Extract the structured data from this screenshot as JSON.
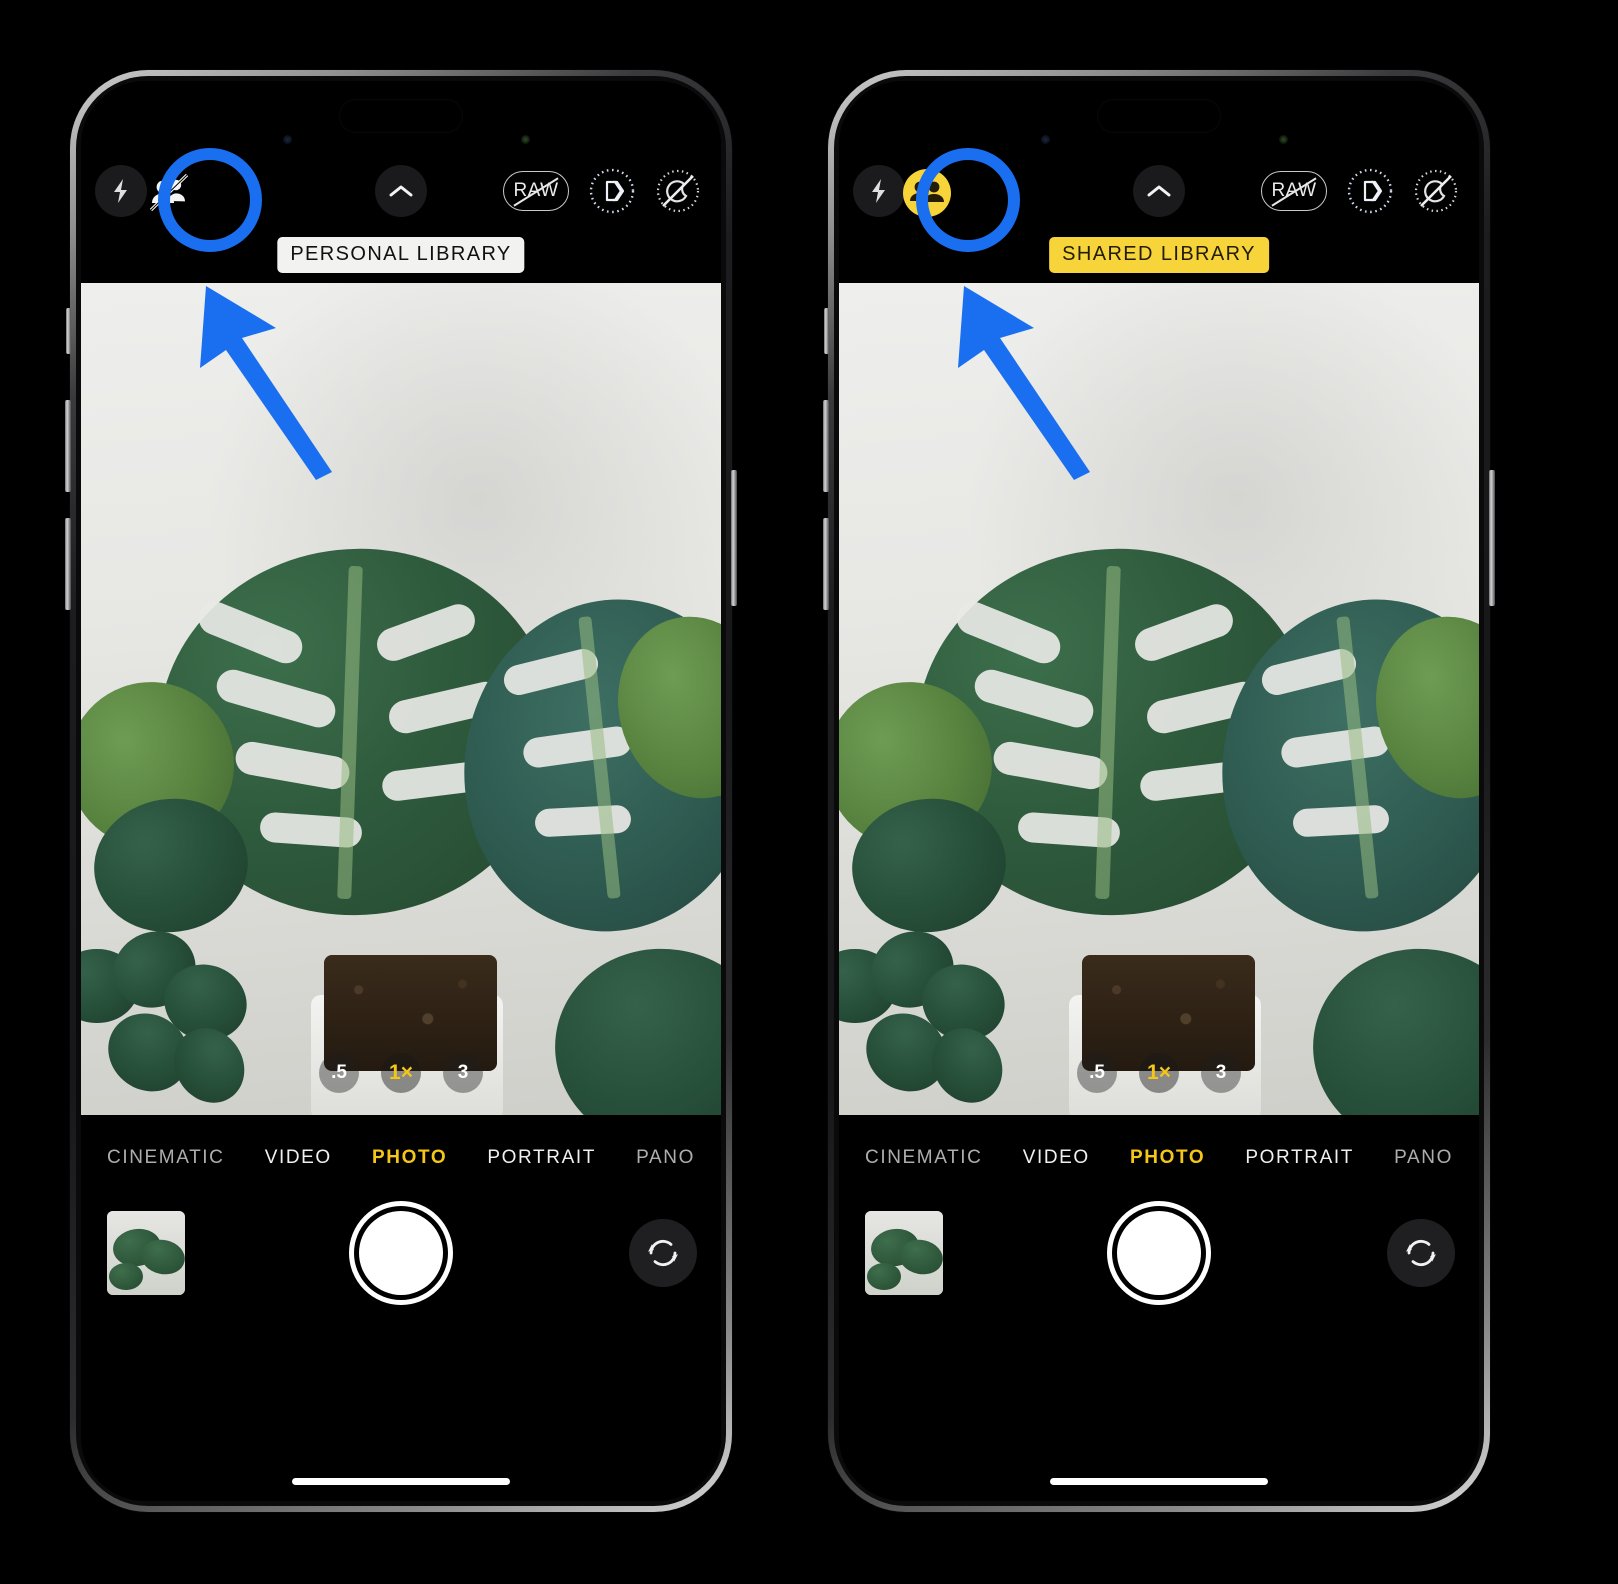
{
  "app": {
    "name": "Camera",
    "platform": "iOS",
    "device": "iPhone 14 Pro"
  },
  "accent_colors": {
    "annotation_blue": "#1a6ff0",
    "shared_yellow": "#f6d43a",
    "mode_active_yellow": "#f5c518",
    "badge_white": "#f2f2f0",
    "badge_text_dark": "#231c06"
  },
  "panels": [
    {
      "id": "personal",
      "name": "personal-library-state",
      "library_badge": {
        "label": "PERSONAL LIBRARY",
        "style": "white",
        "background": "#f2f2f0",
        "text_color": "#111111"
      },
      "shared_library_toggle": {
        "name": "shared-library-toggle",
        "state": "off",
        "icon": "people-slash-icon",
        "icon_color": "#ffffff",
        "highlighted": true
      },
      "top_controls": [
        {
          "name": "flash-button",
          "icon": "flash-icon",
          "label": ""
        },
        {
          "name": "more-controls-button",
          "icon": "chevron-up-icon",
          "label": ""
        },
        {
          "name": "raw-toggle",
          "icon": "raw-off-icon",
          "label": "RAW",
          "state": "off"
        },
        {
          "name": "live-photo-toggle",
          "icon": "live-photo-icon",
          "state": "on"
        },
        {
          "name": "night-mode-toggle",
          "icon": "night-mode-off-icon",
          "state": "off"
        }
      ],
      "zoom_levels": [
        {
          "label": ".5",
          "active": false
        },
        {
          "label": "1×",
          "active": true
        },
        {
          "label": "3",
          "active": false
        }
      ],
      "modes": [
        {
          "label": "CINEMATIC",
          "active": false
        },
        {
          "label": "VIDEO",
          "active": false
        },
        {
          "label": "PHOTO",
          "active": true
        },
        {
          "label": "PORTRAIT",
          "active": false
        },
        {
          "label": "PANO",
          "active": false
        }
      ],
      "bottom_controls": [
        {
          "name": "photo-thumbnail-button",
          "label": ""
        },
        {
          "name": "shutter-button",
          "label": ""
        },
        {
          "name": "camera-flip-button",
          "icon": "camera-flip-icon",
          "label": ""
        }
      ]
    },
    {
      "id": "shared",
      "name": "shared-library-state",
      "library_badge": {
        "label": "SHARED LIBRARY",
        "style": "yellow",
        "background": "#f6d43a",
        "text_color": "#231c06"
      },
      "shared_library_toggle": {
        "name": "shared-library-toggle",
        "state": "on",
        "icon": "people-filled-icon",
        "icon_color": "#f6d43a",
        "highlighted": true
      },
      "top_controls": [
        {
          "name": "flash-button",
          "icon": "flash-icon",
          "label": ""
        },
        {
          "name": "more-controls-button",
          "icon": "chevron-up-icon",
          "label": ""
        },
        {
          "name": "raw-toggle",
          "icon": "raw-off-icon",
          "label": "RAW",
          "state": "off"
        },
        {
          "name": "live-photo-toggle",
          "icon": "live-photo-icon",
          "state": "on"
        },
        {
          "name": "night-mode-toggle",
          "icon": "night-mode-off-icon",
          "state": "off"
        }
      ],
      "zoom_levels": [
        {
          "label": ".5",
          "active": false
        },
        {
          "label": "1×",
          "active": true
        },
        {
          "label": "3",
          "active": false
        }
      ],
      "modes": [
        {
          "label": "CINEMATIC",
          "active": false
        },
        {
          "label": "VIDEO",
          "active": false
        },
        {
          "label": "PHOTO",
          "active": true
        },
        {
          "label": "PORTRAIT",
          "active": false
        },
        {
          "label": "PANO",
          "active": false
        }
      ],
      "bottom_controls": [
        {
          "name": "photo-thumbnail-button",
          "label": ""
        },
        {
          "name": "shutter-button",
          "label": ""
        },
        {
          "name": "camera-flip-button",
          "icon": "camera-flip-icon",
          "label": ""
        }
      ]
    }
  ],
  "annotations": [
    {
      "name": "callout-ring-personal",
      "target": "shared-library-toggle",
      "shape": "circle",
      "color": "#1a6ff0"
    },
    {
      "name": "callout-arrow-personal",
      "target": "shared-library-toggle",
      "shape": "arrow",
      "color": "#1a6ff0"
    },
    {
      "name": "callout-ring-shared",
      "target": "shared-library-toggle",
      "shape": "circle",
      "color": "#1a6ff0"
    },
    {
      "name": "callout-arrow-shared",
      "target": "shared-library-toggle",
      "shape": "arrow",
      "color": "#1a6ff0"
    }
  ],
  "viewfinder": {
    "subject": "monstera deliciosa houseplant in white pot against light gray wall",
    "secondary_subject": "schefflera plant"
  }
}
